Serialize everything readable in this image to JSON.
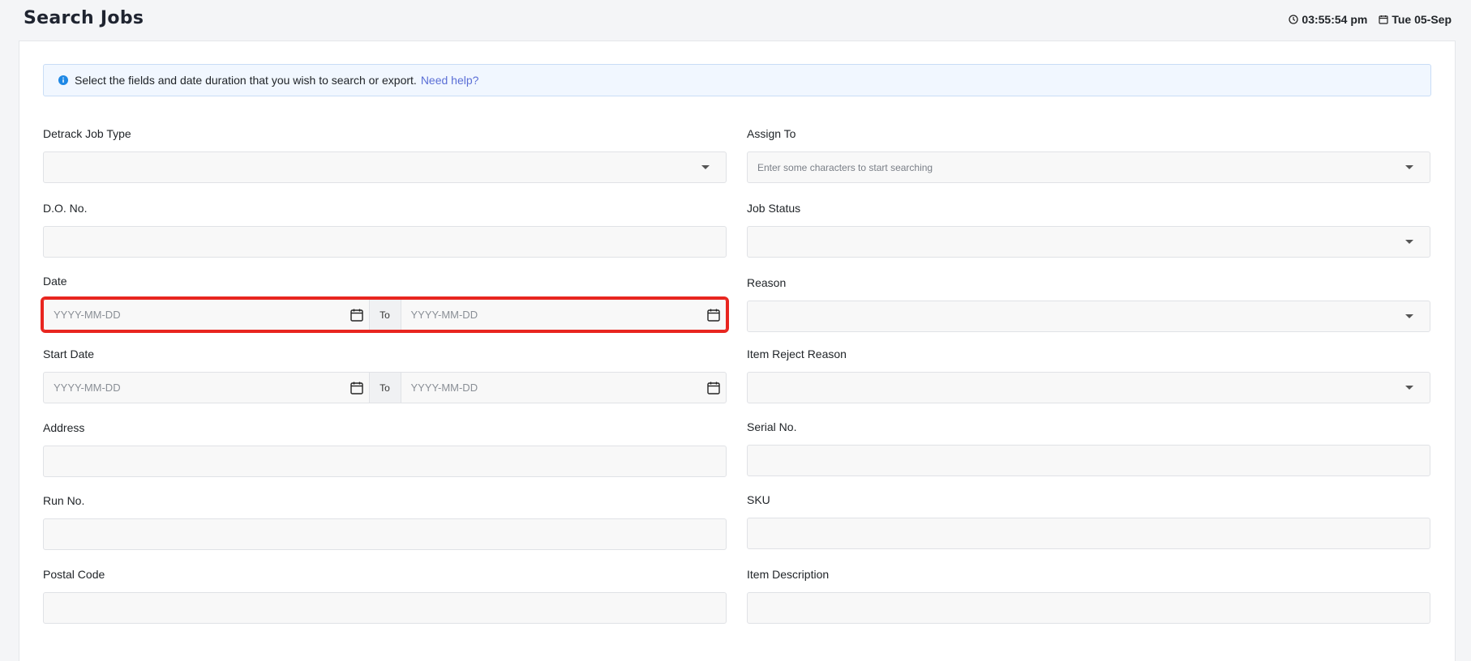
{
  "header": {
    "title": "Search Jobs",
    "time": "03:55:54 pm",
    "date": "Tue 05-Sep"
  },
  "alert": {
    "message": "Select the fields and date duration that you wish to search or export.",
    "help_link": "Need help?"
  },
  "form": {
    "job_type": {
      "label": "Detrack Job Type",
      "value": ""
    },
    "assign_to": {
      "label": "Assign To",
      "placeholder": "Enter some characters to start searching"
    },
    "do_no": {
      "label": "D.O. No.",
      "value": ""
    },
    "job_status": {
      "label": "Job Status",
      "value": ""
    },
    "date": {
      "label": "Date",
      "from_placeholder": "YYYY-MM-DD",
      "to_label": "To",
      "to_placeholder": "YYYY-MM-DD"
    },
    "reason": {
      "label": "Reason",
      "value": ""
    },
    "start_date": {
      "label": "Start Date",
      "from_placeholder": "YYYY-MM-DD",
      "to_label": "To",
      "to_placeholder": "YYYY-MM-DD"
    },
    "item_reject_reason": {
      "label": "Item Reject Reason",
      "value": ""
    },
    "address": {
      "label": "Address",
      "value": ""
    },
    "serial_no": {
      "label": "Serial No.",
      "value": ""
    },
    "run_no": {
      "label": "Run No.",
      "value": ""
    },
    "sku": {
      "label": "SKU",
      "value": ""
    },
    "postal_code": {
      "label": "Postal Code",
      "value": ""
    },
    "item_description": {
      "label": "Item Description",
      "value": ""
    }
  }
}
